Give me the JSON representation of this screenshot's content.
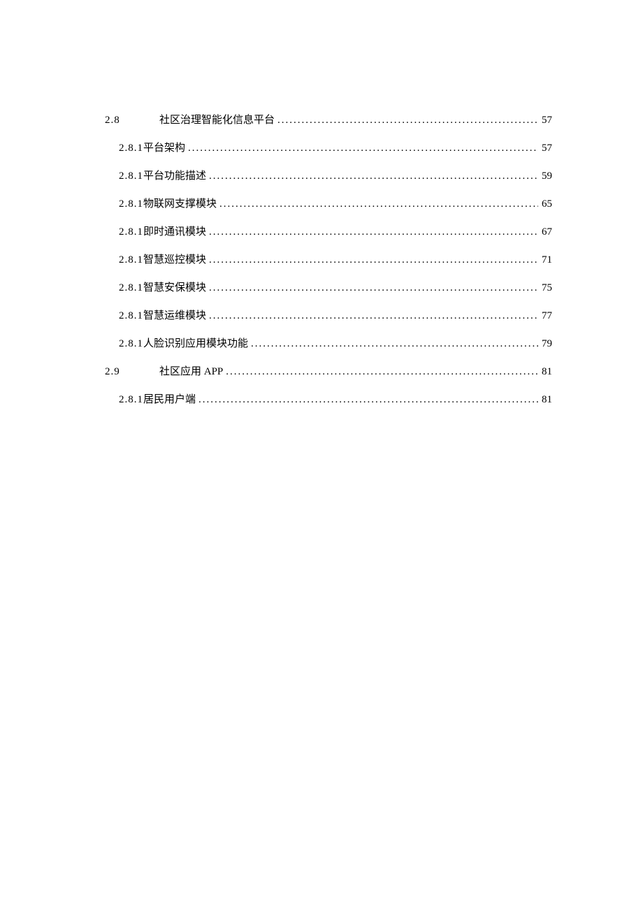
{
  "toc": [
    {
      "level": 1,
      "num": "2.8",
      "title": "社区治理智能化信息平台",
      "page": "57"
    },
    {
      "level": 2,
      "num": "2.8.1",
      "title": "平台架构",
      "page": "57"
    },
    {
      "level": 2,
      "num": "2.8.1",
      "title": "平台功能描述",
      "page": "59"
    },
    {
      "level": 2,
      "num": "2.8.1",
      "title": "物联网支撑模块",
      "page": "65"
    },
    {
      "level": 2,
      "num": "2.8.1",
      "title": "即时通讯模块",
      "page": "67"
    },
    {
      "level": 2,
      "num": "2.8.1",
      "title": "智慧巡控模块",
      "page": "71"
    },
    {
      "level": 2,
      "num": "2.8.1",
      "title": "智慧安保模块",
      "page": "75"
    },
    {
      "level": 2,
      "num": "2.8.1",
      "title": "智慧运维模块",
      "page": "77"
    },
    {
      "level": 2,
      "num": "2.8.1",
      "title": "人脸识别应用模块功能",
      "page": "79"
    },
    {
      "level": 1,
      "num": "2.9",
      "title": "社区应用 APP",
      "page": "81"
    },
    {
      "level": 2,
      "num": "2.8.1",
      "title": "居民用户端",
      "page": "81"
    }
  ]
}
